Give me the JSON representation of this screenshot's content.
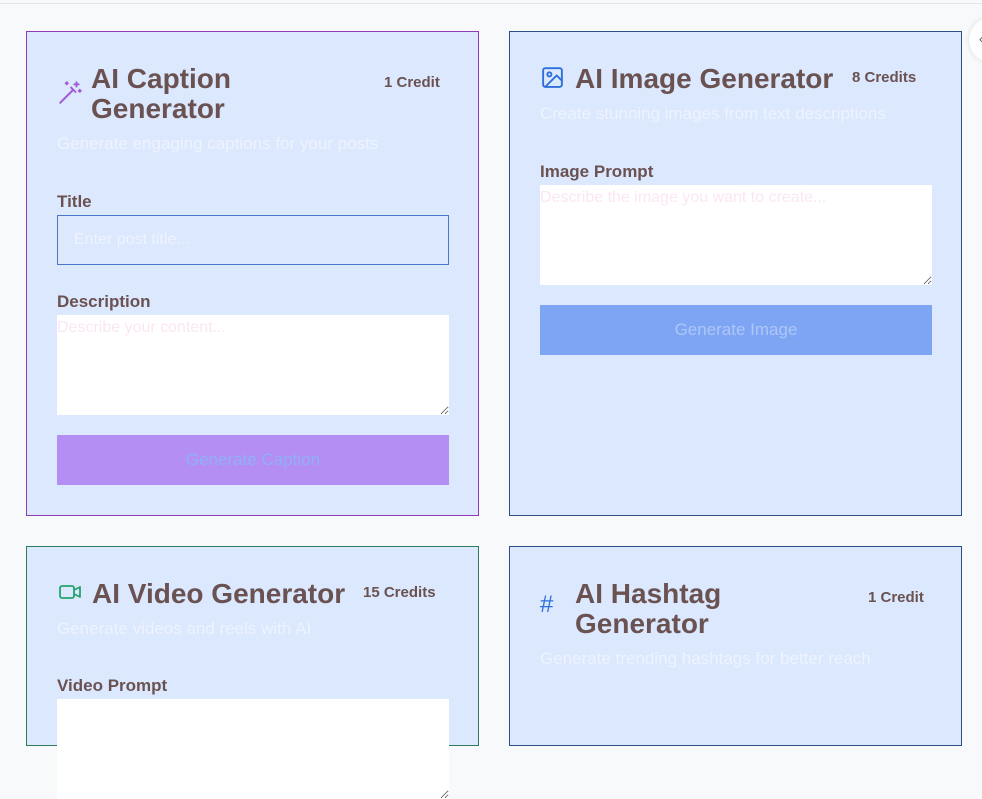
{
  "cards": {
    "caption": {
      "title": "AI Caption Generator",
      "credits": "1 Credit",
      "subtitle": "Generate engaging captions for your posts",
      "title_label": "Title",
      "title_placeholder": "Enter post title...",
      "description_label": "Description",
      "description_placeholder": "Describe your content...",
      "button": "Generate Caption",
      "icon": "magic-wand-icon",
      "accent": "#a35bd6"
    },
    "image": {
      "title": "AI Image Generator",
      "credits": "8 Credits",
      "subtitle": "Create stunning images from text descriptions",
      "prompt_label": "Image Prompt",
      "prompt_placeholder": "Describe the image you want to create...",
      "button": "Generate Image",
      "icon": "image-icon",
      "accent": "#2f6fdb"
    },
    "video": {
      "title": "AI Video Generator",
      "credits": "15 Credits",
      "subtitle": "Generate videos and reels with AI",
      "prompt_label": "Video Prompt",
      "icon": "video-camera-icon",
      "accent": "#26a36b"
    },
    "hashtag": {
      "title": "AI Hashtag Generator",
      "credits": "1 Credit",
      "subtitle": "Generate trending hashtags for better reach",
      "icon": "hashtag-icon",
      "icon_glyph": "#",
      "accent": "#2f6fdb"
    }
  },
  "colors": {
    "card_bg": "#dbe8fd",
    "text": "#6b5252",
    "caption_button": "#b48ef2",
    "image_button": "#7ea5f4"
  }
}
